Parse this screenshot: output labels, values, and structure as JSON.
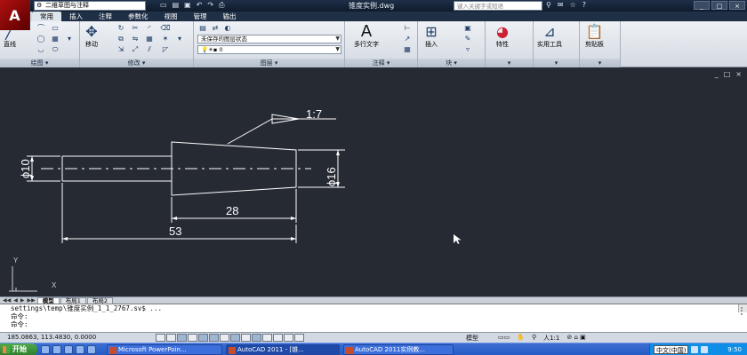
{
  "titlebar": {
    "app_logo": "A",
    "workspace": "二维草图与注释",
    "qat_icons": [
      "new-icon",
      "open-icon",
      "save-icon",
      "undo-icon",
      "redo-icon",
      "print-icon"
    ],
    "document_title": "锥度实例.dwg",
    "search_placeholder": "键入关键字或短语",
    "window_buttons": [
      "_",
      "□",
      "×"
    ]
  },
  "tabs": [
    "常用",
    "插入",
    "注释",
    "参数化",
    "视图",
    "管理",
    "输出"
  ],
  "active_tab": "常用",
  "ribbon": {
    "draw_panel": {
      "title": "绘图",
      "line_label": "直线"
    },
    "modify_panel": {
      "title": "修改",
      "move_label": "移动"
    },
    "layers_panel": {
      "title": "图层",
      "layer_state": "未保存的图层状态",
      "current_layer": "0"
    },
    "annotation_panel": {
      "title": "注释",
      "mtext_label": "多行文字"
    },
    "block_panel": {
      "title": "块",
      "insert_label": "插入"
    },
    "properties_panel": {
      "label": "特性"
    },
    "utilities_panel": {
      "label": "实用工具"
    },
    "clipboard_panel": {
      "label": "剪贴板"
    }
  },
  "drawing": {
    "taper_label": "1:7",
    "dim_left_diameter": "ϕ10",
    "dim_right_diameter": "ϕ16",
    "dim_taper_length": "28",
    "dim_total_length": "53",
    "ucs_x": "X",
    "ucs_y": "Y",
    "viewport_controls": [
      "_",
      "□",
      "×"
    ],
    "colors": {
      "background": "#252a33",
      "lines": "#ffffff"
    }
  },
  "layout_tabs": [
    "模型",
    "布局1",
    "布局2"
  ],
  "command_line": {
    "history_1": "settings\\temp\\锥度实例_1_1_2767.sv$ ...",
    "history_2": "命令:",
    "prompt": "命令:"
  },
  "statusbar": {
    "coordinates": "185.0863, 113.4830, 0.0000",
    "model_label": "模型",
    "annotation_scale": "人1:1",
    "extra": "⊘ ⌂ ▣"
  },
  "taskbar": {
    "start_label": "开始",
    "tasks": [
      "Microsoft PowerPoin...",
      "AutoCAD 2011 - [锥...",
      "AutoCAD 2011实例教..."
    ],
    "ime": "中文(中国)",
    "clock": "9:50"
  }
}
